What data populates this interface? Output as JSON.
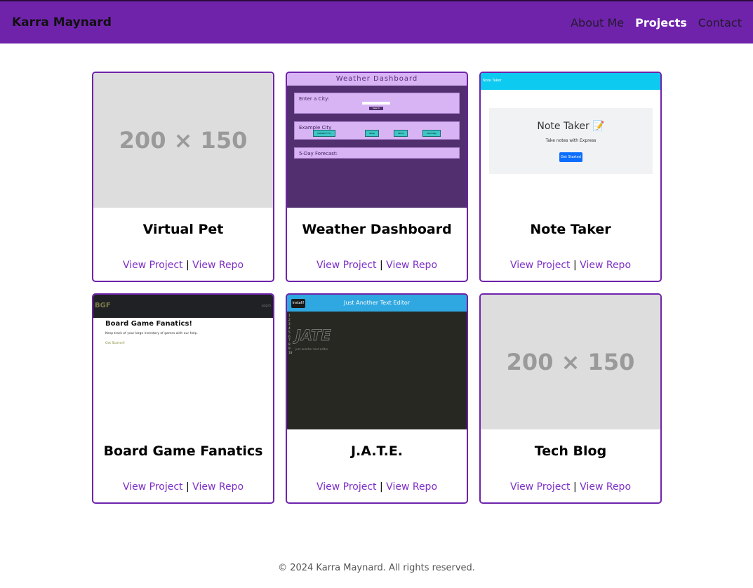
{
  "header": {
    "brand": "Karra Maynard",
    "nav": [
      {
        "label": "About Me",
        "active": false
      },
      {
        "label": "Projects",
        "active": true
      },
      {
        "label": "Contact",
        "active": false
      }
    ]
  },
  "projects": [
    {
      "title": "Virtual Pet",
      "placeholder": "200 × 150",
      "view_project": "View Project",
      "separator": "|",
      "view_repo": "View Repo"
    },
    {
      "title": "Weather Dashboard",
      "view_project": "View Project",
      "separator": "|",
      "view_repo": "View Repo",
      "thumb": {
        "header": "Weather Dashboard",
        "enter_city": "Enter a City:",
        "search": "Search",
        "example_city": "Example City",
        "date": "(00/00/YYYY)",
        "temp": "Temp",
        "wind": "Wind",
        "humidity": "Humidity",
        "forecast": "5-Day Forecast:"
      }
    },
    {
      "title": "Note Taker",
      "view_project": "View Project",
      "separator": "|",
      "view_repo": "View Repo",
      "thumb": {
        "nav": "Note Taker",
        "heading": "Note Taker 📝",
        "sub": "Take notes with Express",
        "button": "Get Started"
      }
    },
    {
      "title": "Board Game Fanatics",
      "view_project": "View Project",
      "separator": "|",
      "view_repo": "View Repo",
      "thumb": {
        "logo": "BGF",
        "login": "Login",
        "heading": "Board Game Fanatics!",
        "text": "Keep track of your large inventory of games with our help.",
        "cta": "Get Started!"
      }
    },
    {
      "title": "J.A.T.E.",
      "view_project": "View Project",
      "separator": "|",
      "view_repo": "View Repo",
      "thumb": {
        "install": "Install!",
        "title": "Just Another Text Editor",
        "lines": "1\n2\n3\n4\n5\n6\n7\n8\n9\n10",
        "logo": "JATE",
        "sub": "just another text editor"
      }
    },
    {
      "title": "Tech Blog",
      "placeholder": "200 × 150",
      "view_project": "View Project",
      "separator": "|",
      "view_repo": "View Repo"
    }
  ],
  "footer": {
    "text": "© 2024 Karra Maynard. All rights reserved."
  },
  "colors": {
    "primary": "#6f23ab",
    "link": "#7d2fc7"
  }
}
